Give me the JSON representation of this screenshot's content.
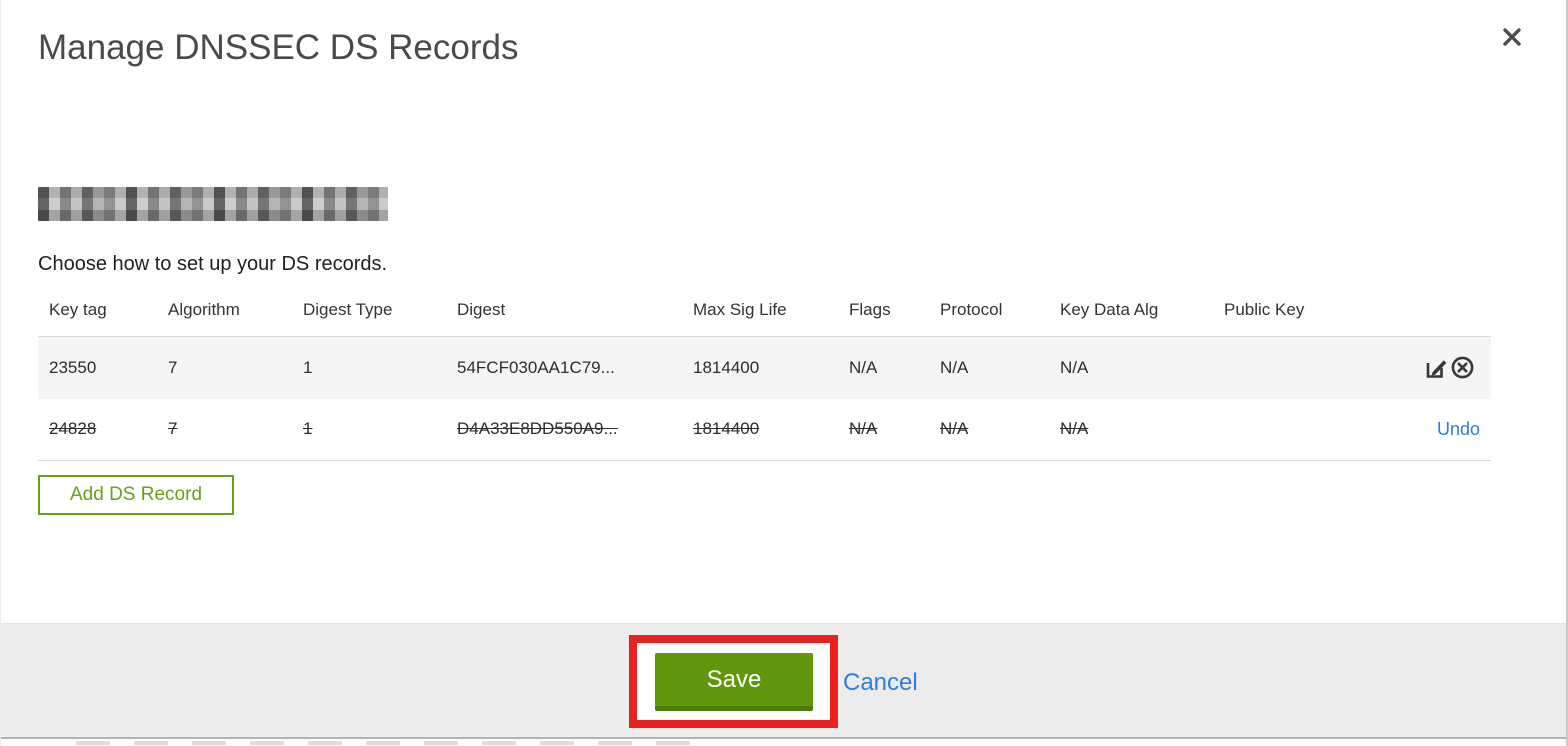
{
  "modal": {
    "title": "Manage DNSSEC DS Records"
  },
  "body": {
    "subtitle": "Choose how to set up your DS records.",
    "add_button_label": "Add DS Record"
  },
  "table": {
    "columns": [
      "Key tag",
      "Algorithm",
      "Digest Type",
      "Digest",
      "Max Sig Life",
      "Flags",
      "Protocol",
      "Key Data Alg",
      "Public Key"
    ],
    "rows": [
      {
        "key_tag": "23550",
        "algorithm": "7",
        "digest_type": "1",
        "digest": "54FCF030AA1C79...",
        "max_sig_life": "1814400",
        "flags": "N/A",
        "protocol": "N/A",
        "key_data_alg": "N/A",
        "public_key": "",
        "state": "current"
      },
      {
        "key_tag": "24828",
        "algorithm": "7",
        "digest_type": "1",
        "digest": "D4A33E8DD550A9...",
        "max_sig_life": "1814400",
        "flags": "N/A",
        "protocol": "N/A",
        "key_data_alg": "N/A",
        "public_key": "",
        "state": "deleted",
        "action_label": "Undo"
      }
    ]
  },
  "footer": {
    "save_label": "Save",
    "cancel_label": "Cancel"
  },
  "colors": {
    "accent_green": "#61970e",
    "green_outline": "#6d9f16",
    "link_blue": "#2d7ce0",
    "annotation_red": "#e8231f",
    "row_alt_background": "#f5f5f5",
    "footer_background": "#ececec"
  }
}
